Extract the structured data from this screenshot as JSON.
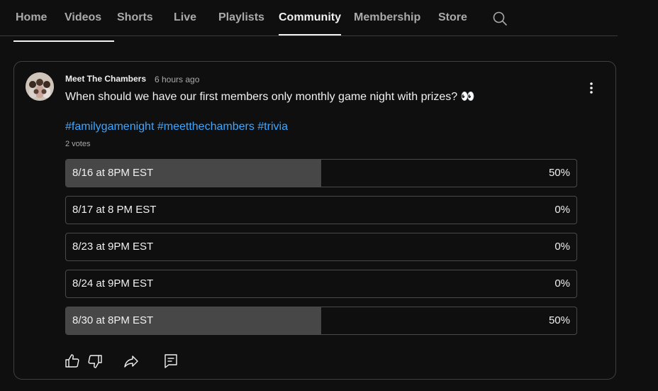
{
  "tabs": [
    {
      "label": "Home",
      "active": false
    },
    {
      "label": "Videos",
      "active": false
    },
    {
      "label": "Shorts",
      "active": false
    },
    {
      "label": "Live",
      "active": false
    },
    {
      "label": "Playlists",
      "active": false
    },
    {
      "label": "Community",
      "active": true
    },
    {
      "label": "Membership",
      "active": false
    },
    {
      "label": "Store",
      "active": false
    }
  ],
  "search": {
    "icon": "search-icon"
  },
  "post": {
    "author": "Meet The Chambers",
    "time": "6 hours ago",
    "text": "When should we have our first members only monthly game night with prizes? 👀",
    "hashtags": [
      "#familygamenight",
      "#meetthechambers",
      "#trivia"
    ],
    "votes": "2 votes",
    "options": [
      {
        "label": "8/16 at 8PM EST",
        "percent": "50%",
        "fraction": 0.5
      },
      {
        "label": "8/17 at 8 PM EST",
        "percent": "0%",
        "fraction": 0
      },
      {
        "label": "8/23 at 9PM EST",
        "percent": "0%",
        "fraction": 0
      },
      {
        "label": "8/24 at 9PM EST",
        "percent": "0%",
        "fraction": 0
      },
      {
        "label": "8/30 at 8PM EST",
        "percent": "50%",
        "fraction": 0.5
      }
    ]
  },
  "actions": {
    "like": "thumbs-up-icon",
    "dislike": "thumbs-down-icon",
    "share": "share-icon",
    "comment": "comment-icon"
  }
}
